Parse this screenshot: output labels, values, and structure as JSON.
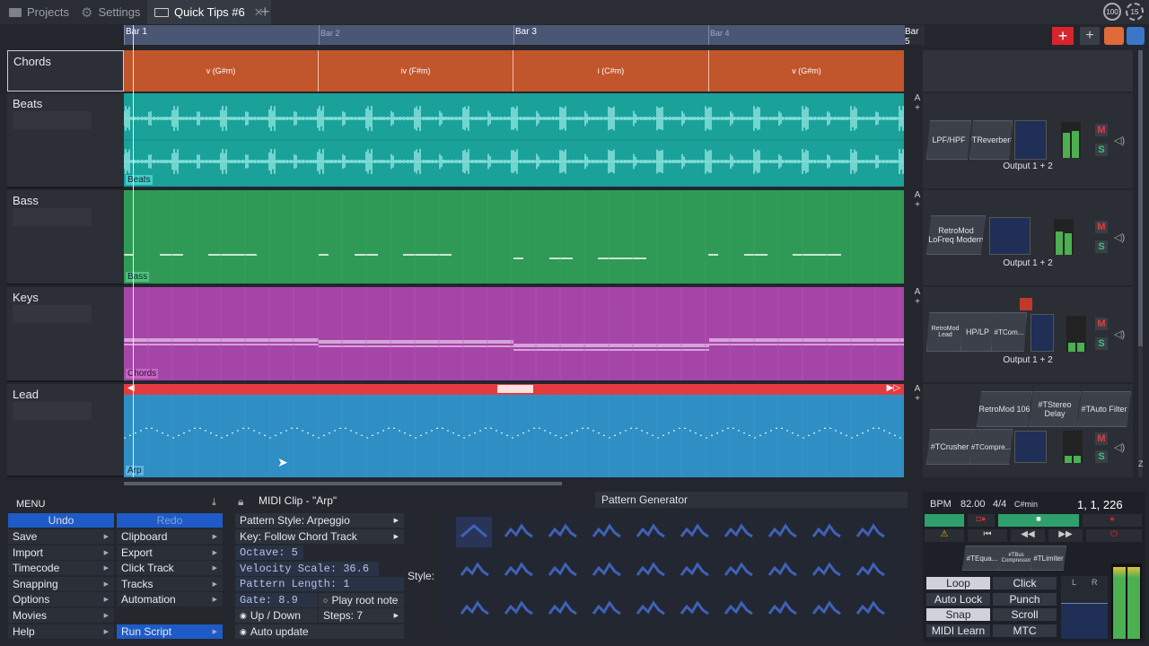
{
  "tabs": [
    {
      "label": "Projects"
    },
    {
      "label": "Settings"
    },
    {
      "label": "Quick Tips #6"
    }
  ],
  "cpu": {
    "value1": "100",
    "value2": "15"
  },
  "ruler": {
    "bar1": "Bar 1",
    "bar2": "Bar 2",
    "bar3": "Bar 3",
    "bar4": "Bar 4",
    "bar5": "Bar 5"
  },
  "tracks": [
    {
      "name": "Chords",
      "chords": [
        "v (G#m)",
        "iv (F#m)",
        "i (C#m)",
        "v (G#m)"
      ]
    },
    {
      "name": "Beats",
      "clip": "Beats",
      "fx": [
        "LPF/HPF",
        "#TReverber8"
      ],
      "output": "Output 1 + 2"
    },
    {
      "name": "Bass",
      "clip": "Bass",
      "fx": [
        "RetroMod LoFreq Modern"
      ],
      "output": "Output 1 + 2"
    },
    {
      "name": "Keys",
      "clip": "Chords",
      "fx": [
        "RetroMod Lead",
        "HP/LP",
        "#TCom..."
      ],
      "output": "Output 1 + 2"
    },
    {
      "name": "Lead",
      "clip": "Arp",
      "fx_top": [
        "RetroMod 106",
        "#TStereo Delay",
        "#TAuto Filter"
      ],
      "fx": [
        "#TCrusher",
        "#TCompre..."
      ]
    }
  ],
  "mute_label": "M",
  "solo_label": "S",
  "auto_label": "A",
  "plus_label": "+",
  "colors": {
    "chords": "#c1552b",
    "beats": "#1aa19a",
    "bass": "#2e9a55",
    "keys": "#a545a8",
    "lead": "#2f8fc4",
    "clipbar": "#e33b3f",
    "ruler": "#4a5674"
  },
  "menu": {
    "title": "MENU",
    "undo": "Undo",
    "redo": "Redo",
    "left": [
      "Save",
      "Import",
      "Timecode",
      "Snapping",
      "Options",
      "Movies",
      "Help"
    ],
    "right": [
      "Clipboard",
      "Export",
      "Click Track",
      "Tracks",
      "Automation",
      "",
      "Run Script"
    ]
  },
  "midi": {
    "title": "MIDI Clip - \"Arp\"",
    "pattern_gen": "Pattern Generator",
    "pattern_style": "Pattern Style: Arpeggio",
    "key": "Key: Follow Chord Track",
    "octave": "Octave: 5",
    "velocity": "Velocity Scale: 36.6",
    "length": "Pattern Length: 1",
    "gate": "Gate: 8.9",
    "play_root": "Play root note",
    "updown": "Up / Down",
    "steps": "Steps: 7",
    "auto_update": "Auto update",
    "style_label": "Style:"
  },
  "transport": {
    "bpm_label": "BPM",
    "bpm": "82.00",
    "sig": "4/4",
    "key": "C#min",
    "position": "1, 1, 226",
    "loop": "Loop",
    "click": "Click",
    "autolock": "Auto Lock",
    "punch": "Punch",
    "snap": "Snap",
    "scroll": "Scroll",
    "midilearn": "MIDI Learn",
    "mtc": "MTC",
    "master_fx": [
      "#TEqua...",
      "#TBus Compressor",
      "#TLimiter"
    ],
    "meter_l": "L",
    "meter_r": "R"
  },
  "zoom_hint": "Z"
}
